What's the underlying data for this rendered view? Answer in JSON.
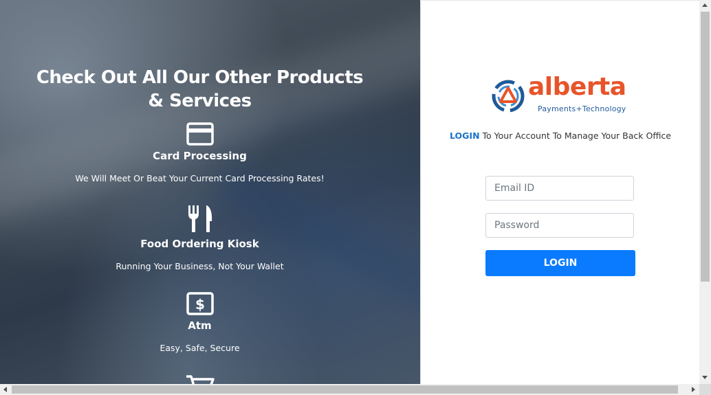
{
  "promo": {
    "title": "Check Out All Our Other Products & Services",
    "services": [
      {
        "icon": "credit-card-icon",
        "name": "Card Processing",
        "description": "We Will Meet Or Beat Your Current Card Processing Rates!"
      },
      {
        "icon": "fork-knife-icon",
        "name": "Food Ordering Kiosk",
        "description": "Running Your Business, Not Your Wallet"
      },
      {
        "icon": "money-bill-icon",
        "name": "Atm",
        "description": "Easy, Safe, Secure"
      },
      {
        "icon": "shopping-cart-icon"
      }
    ]
  },
  "login": {
    "logo_text": "alberta",
    "logo_subtitle": "Payments+Technology",
    "tagline_highlight": "LOGIN",
    "tagline_rest": " To Your Account To Manage Your Back Office",
    "email_placeholder": "Email ID",
    "password_placeholder": "Password",
    "button_label": "LOGIN"
  },
  "colors": {
    "accent_blue": "#0a7bff",
    "logo_orange": "#e8542a",
    "logo_blue": "#1f5a9a"
  }
}
